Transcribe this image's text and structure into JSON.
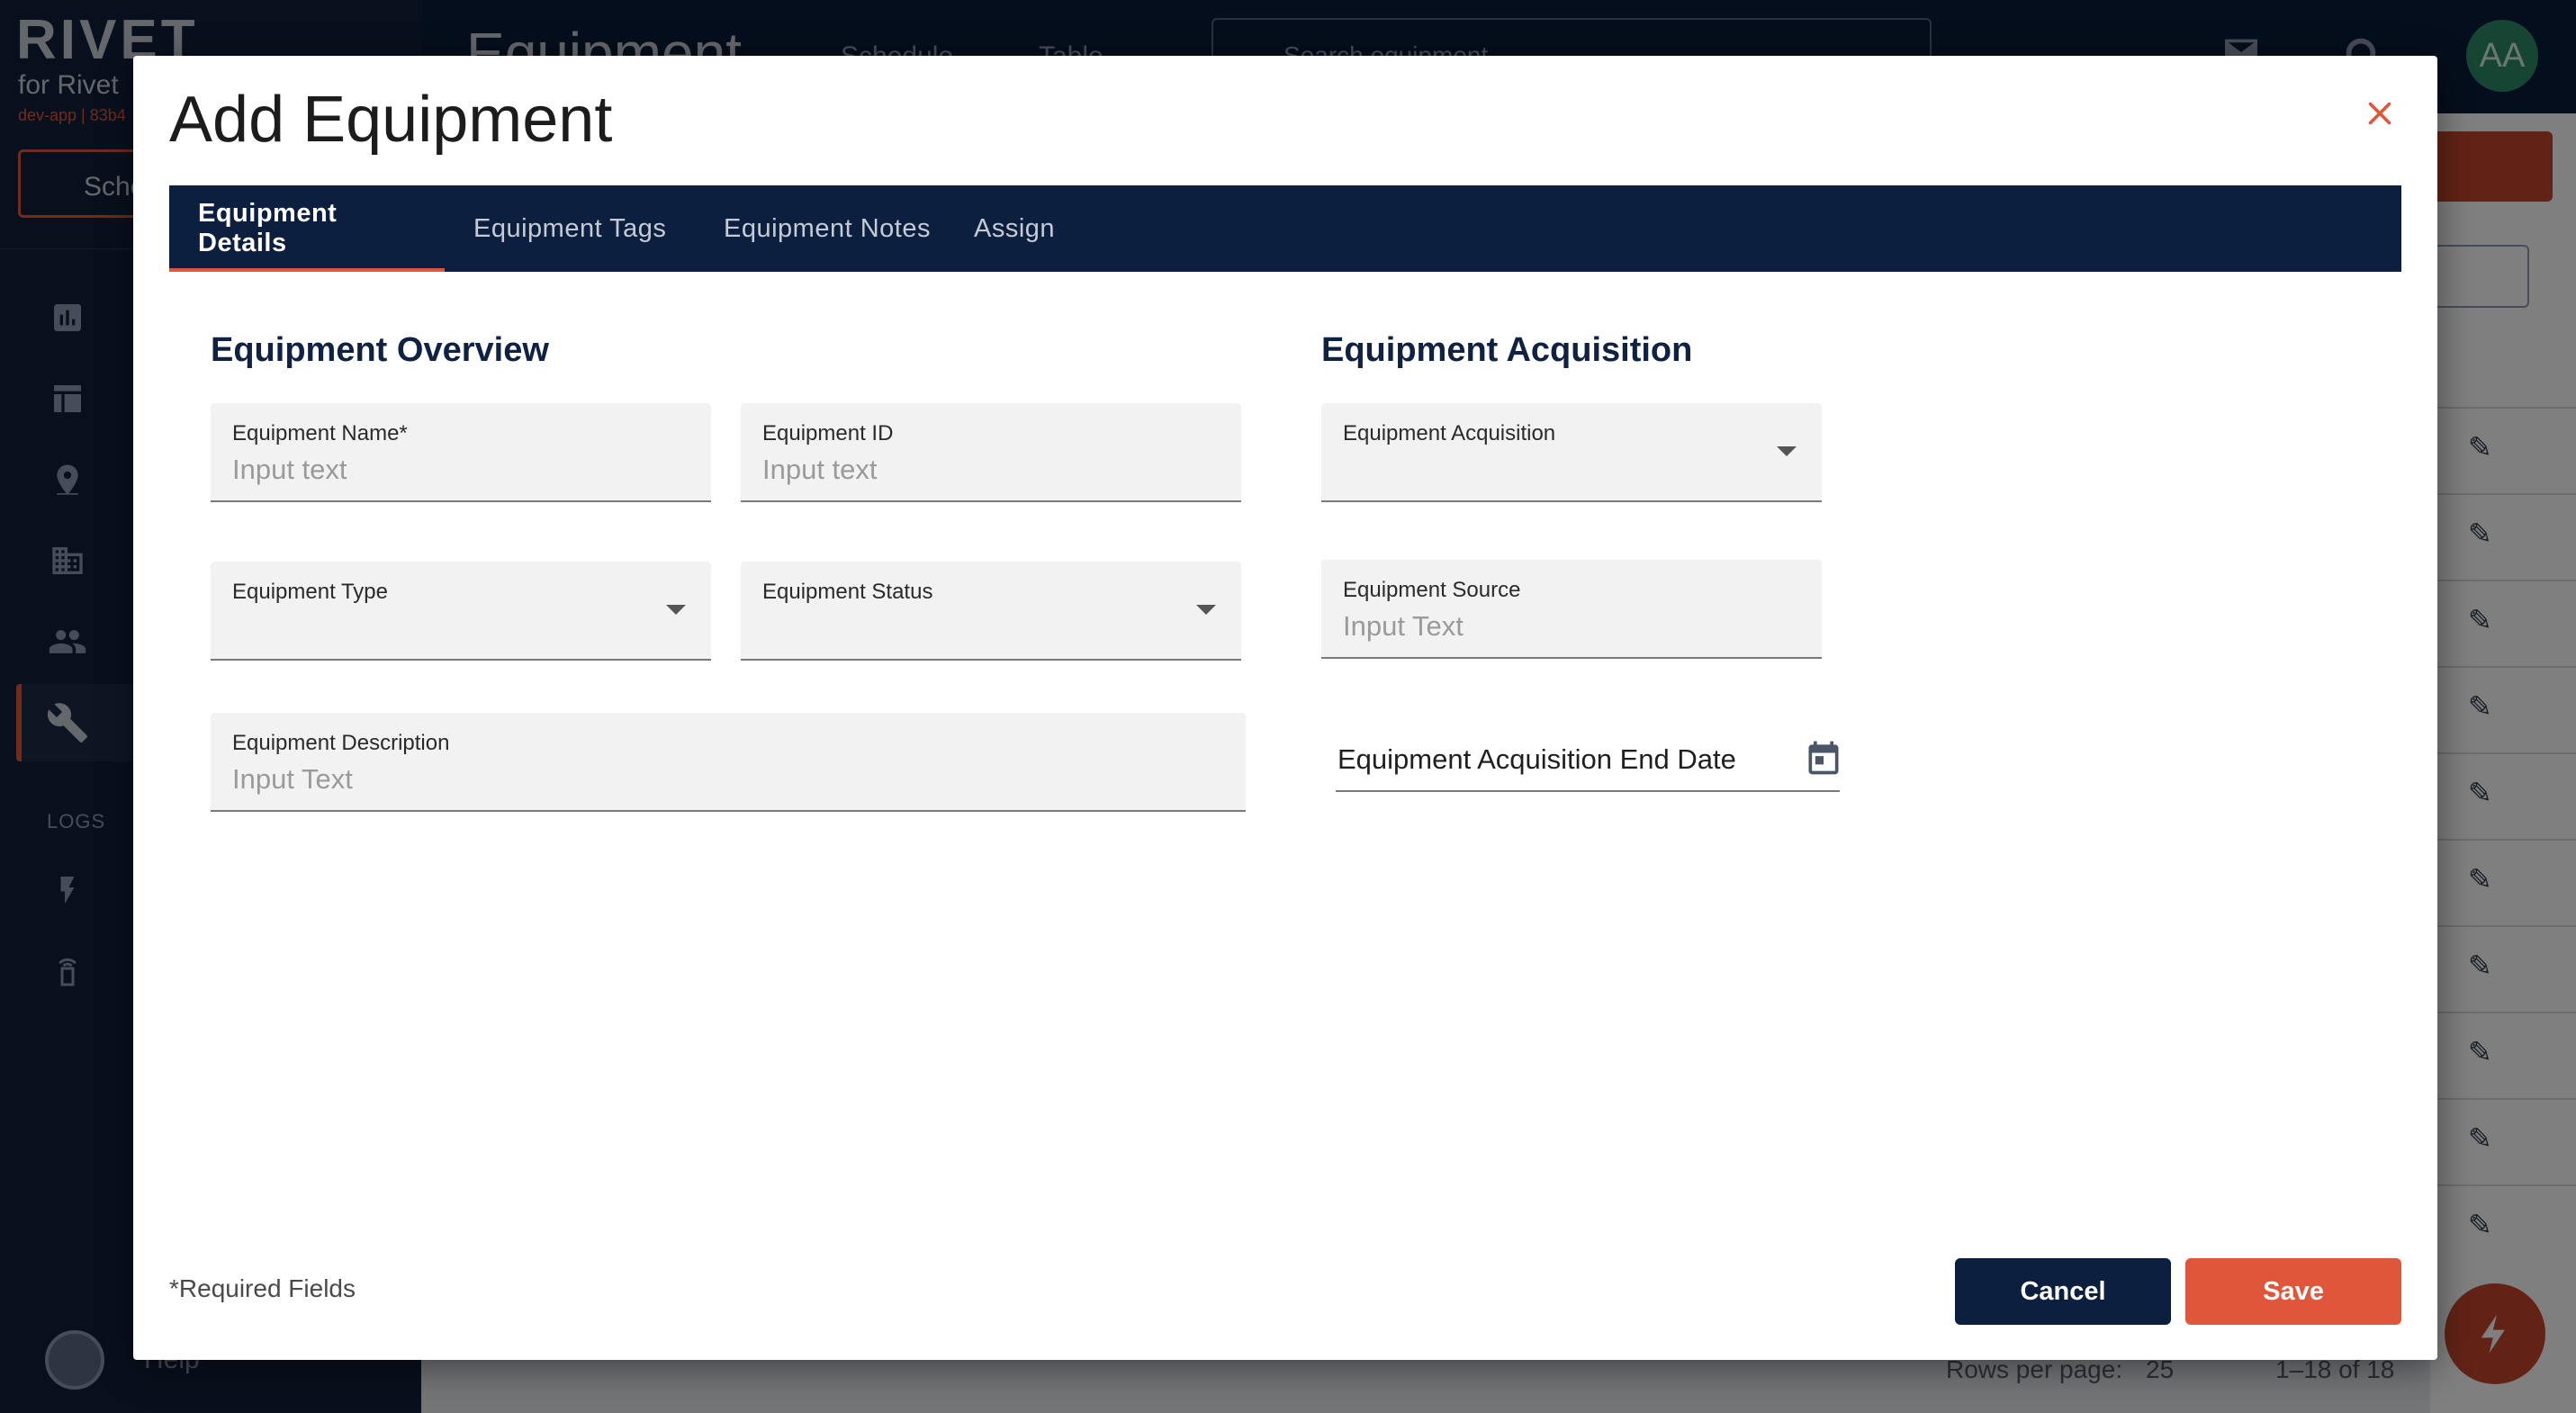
{
  "app": {
    "logo": "RIVET",
    "logo_sub": "for Rivet",
    "env": "dev-app | 83b4",
    "schedule_btn": "Sche",
    "logs_label": "LOGS",
    "help_label": "Help",
    "page_title": "Equipment",
    "top_tabs": [
      "Schedule",
      "Table"
    ],
    "search_placeholder": "Search equipment",
    "user_initials": "AA",
    "pager": {
      "rows_label": "Rows per page:",
      "rows_value": "25",
      "range": "1–18 of 18"
    }
  },
  "modal": {
    "title": "Add Equipment",
    "tabs": [
      "Equipment Details",
      "Equipment Tags",
      "Equipment Notes",
      "Assign"
    ],
    "active_tab": "Equipment Details",
    "overview": {
      "title": "Equipment Overview",
      "name": {
        "label": "Equipment Name*",
        "placeholder": "Input text"
      },
      "id": {
        "label": "Equipment ID",
        "placeholder": "Input text"
      },
      "type": {
        "label": "Equipment Type",
        "value": ""
      },
      "status": {
        "label": "Equipment Status",
        "value": ""
      },
      "description": {
        "label": "Equipment Description",
        "placeholder": "Input Text"
      }
    },
    "acquisition": {
      "title": "Equipment Acquisition",
      "acquisition": {
        "label": "Equipment Acquisition",
        "value": ""
      },
      "source": {
        "label": "Equipment Source",
        "placeholder": "Input Text"
      },
      "end_date": {
        "label": "Equipment Acquisition End Date"
      }
    },
    "required_note": "*Required Fields",
    "cancel_label": "Cancel",
    "save_label": "Save"
  },
  "colors": {
    "navy": "#0c1f3f",
    "accent": "#e0563a",
    "field_bg": "#f2f2f2"
  }
}
